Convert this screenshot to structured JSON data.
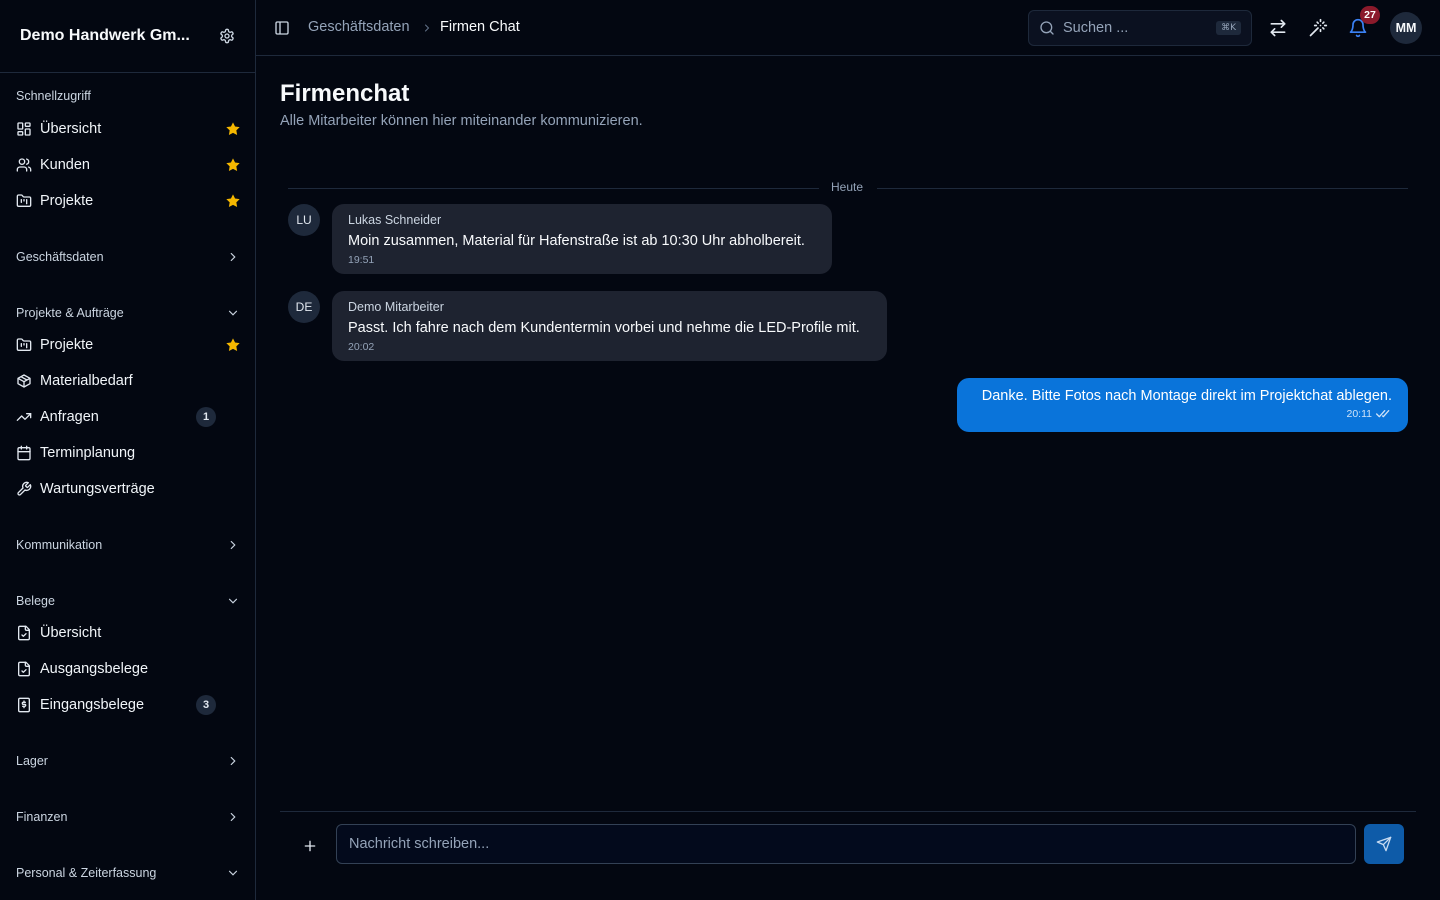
{
  "sidebar": {
    "company": "Demo Handwerk Gm...",
    "quick": {
      "label": "Schnellzugriff",
      "items": [
        {
          "label": "Übersicht",
          "icon": "dashboard-icon"
        },
        {
          "label": "Kunden",
          "icon": "users-icon"
        },
        {
          "label": "Projekte",
          "icon": "folder-kanban-icon"
        }
      ]
    },
    "groups": {
      "geschaeftsdaten": "Geschäftsdaten",
      "projekte": "Projekte & Aufträge",
      "kommunikation": "Kommunikation",
      "belege": "Belege",
      "lager": "Lager",
      "finanzen": "Finanzen",
      "personal": "Personal & Zeiterfassung"
    },
    "projekte_items": [
      {
        "label": "Projekte",
        "starred": true
      },
      {
        "label": "Materialbedarf"
      },
      {
        "label": "Anfragen",
        "count": "1"
      },
      {
        "label": "Terminplanung"
      },
      {
        "label": "Wartungsverträge"
      }
    ],
    "belege_items": [
      {
        "label": "Übersicht"
      },
      {
        "label": "Ausgangsbelege"
      },
      {
        "label": "Eingangsbelege",
        "count": "3"
      }
    ]
  },
  "topbar": {
    "breadcrumb_parent": "Geschäftsdaten",
    "breadcrumb_current": "Firmen Chat",
    "search_placeholder": "Suchen ...",
    "search_shortcut": "⌘K",
    "notification_count": "27",
    "user_initials": "MM"
  },
  "page": {
    "title": "Firmenchat",
    "subtitle": "Alle Mitarbeiter können hier miteinander kommunizieren."
  },
  "chat": {
    "day_label": "Heute",
    "messages": [
      {
        "initials": "LU",
        "author": "Lukas Schneider",
        "text": "Moin zusammen, Material für Hafenstraße ist ab 10:30 Uhr abholbereit.",
        "time": "19:51"
      },
      {
        "initials": "DE",
        "author": "Demo Mitarbeiter",
        "text": "Passt. Ich fahre nach dem Kundentermin vorbei und nehme die LED-Profile mit.",
        "time": "20:02"
      }
    ],
    "own_message": {
      "text": "Danke. Bitte Fotos nach Montage direkt im Projektchat ablegen.",
      "time": "20:11"
    }
  },
  "composer": {
    "placeholder": "Nachricht schreiben..."
  },
  "colors": {
    "background": "#030711",
    "own_bubble": "#0a74da",
    "star": "#f5b700",
    "badge": "#8b1a2b"
  }
}
